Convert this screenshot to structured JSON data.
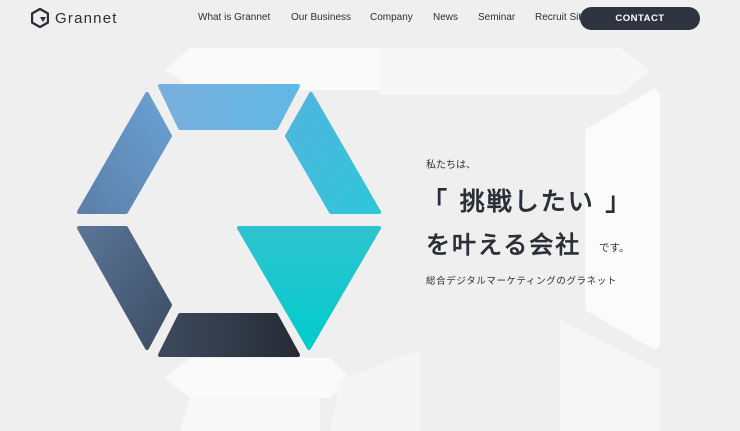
{
  "brand": {
    "name": "Grannet"
  },
  "nav": {
    "items": [
      "What is Grannet",
      "Our Business",
      "Company",
      "News",
      "Seminar",
      "Recruit Site"
    ],
    "contact_label": "CONTACT"
  },
  "hero": {
    "intro": "私たちは、",
    "headline_line1": "「 挑戦したい 」",
    "headline_line2": "を叶える会社",
    "suffix": "です。",
    "tagline": "総合デジタルマーケティングのグラネット"
  },
  "colors": {
    "dark": "#2f3441",
    "accent_cyan": "#00cccc",
    "blue_light": "#6bb5e3",
    "slate": "#556b88"
  }
}
